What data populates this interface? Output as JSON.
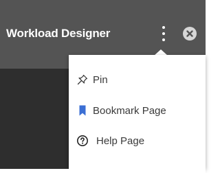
{
  "header": {
    "title": "Workload Designer"
  },
  "menu": {
    "items": [
      {
        "label": "Pin",
        "icon": "pin-icon"
      },
      {
        "label": "Bookmark Page",
        "icon": "bookmark-icon"
      },
      {
        "label": "Help Page",
        "icon": "help-circle-icon"
      }
    ]
  },
  "colors": {
    "header_bg": "#545454",
    "body_bg": "#2e2e2e",
    "bookmark_accent": "#3b6fd4",
    "text": "#3a3a3a"
  }
}
